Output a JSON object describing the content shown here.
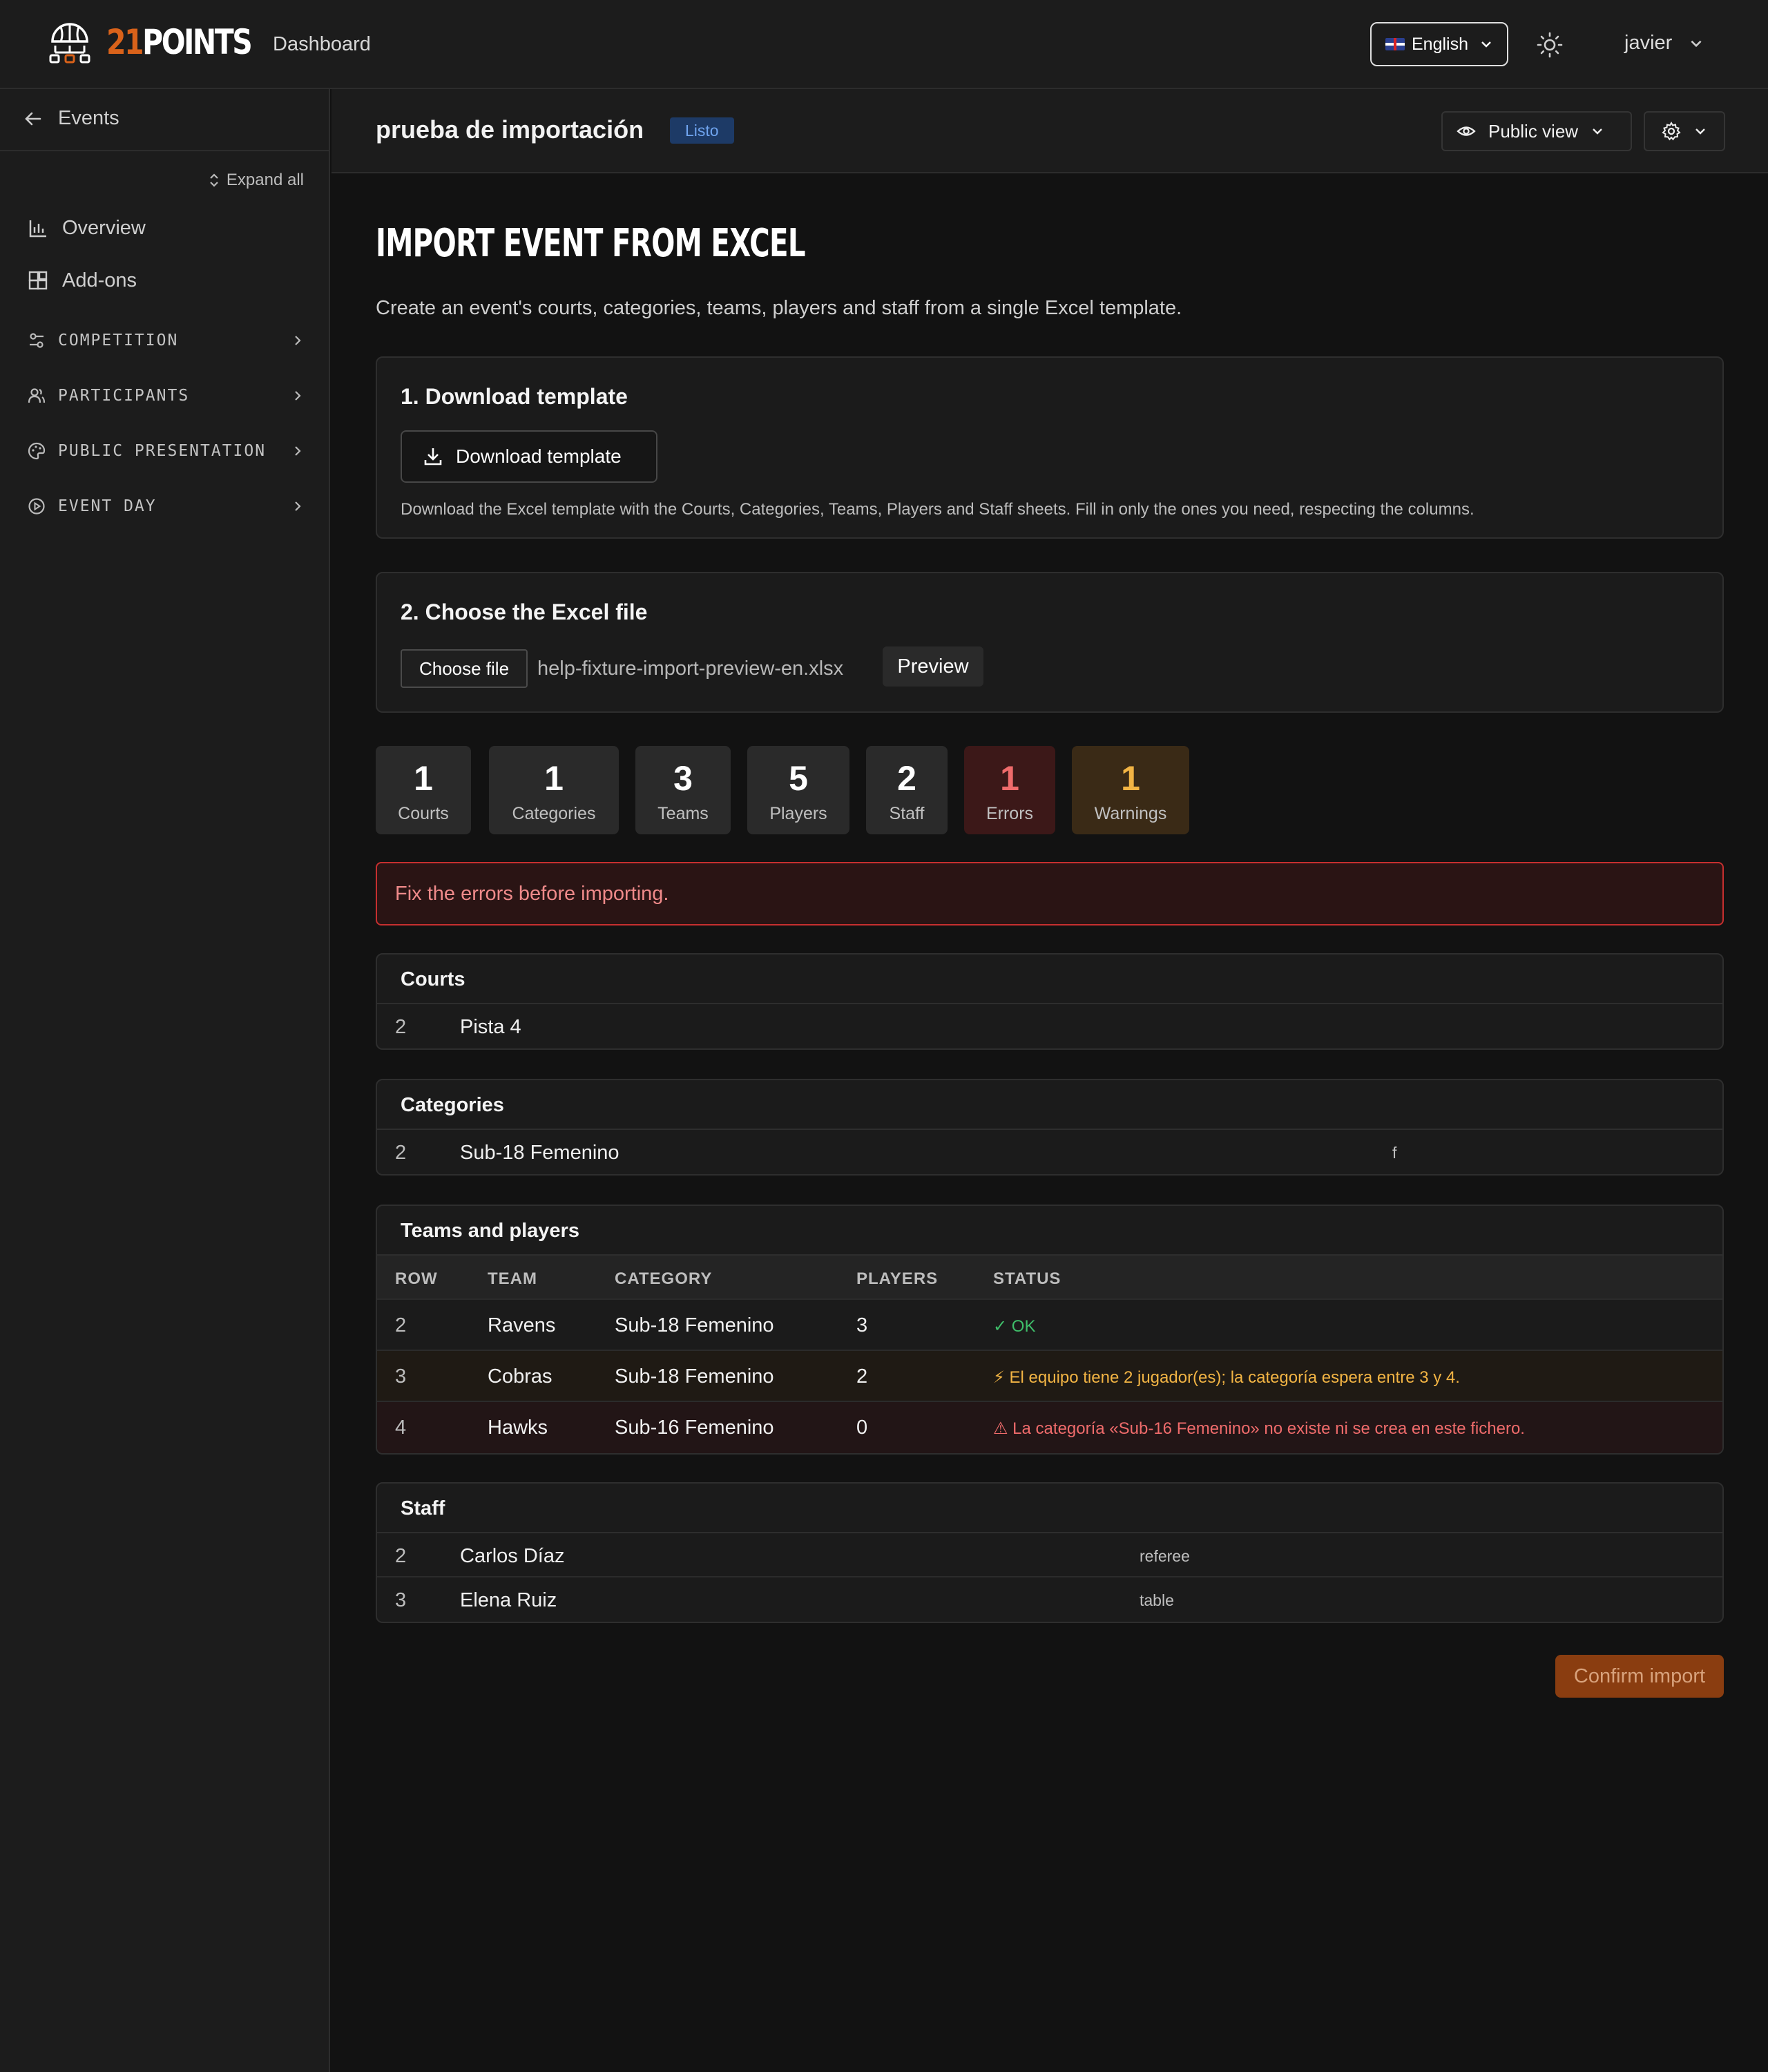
{
  "topbar": {
    "logo_num": "21",
    "logo_word": "POINTS",
    "nav_dashboard": "Dashboard",
    "language": "English",
    "user": "javier"
  },
  "sidebar": {
    "back": "Events",
    "expand_all": "Expand all",
    "links": [
      {
        "label": "Overview",
        "icon": "bar-chart-icon"
      },
      {
        "label": "Add-ons",
        "icon": "puzzle-icon"
      }
    ],
    "groups": [
      {
        "label": "COMPETITION",
        "icon": "sliders-icon"
      },
      {
        "label": "PARTICIPANTS",
        "icon": "users-icon"
      },
      {
        "label": "PUBLIC PRESENTATION",
        "icon": "palette-icon"
      },
      {
        "label": "EVENT DAY",
        "icon": "play-circle-icon"
      }
    ]
  },
  "header": {
    "title": "prueba de importación",
    "status": "Listo",
    "public_view": "Public view"
  },
  "main": {
    "heading": "IMPORT EVENT FROM EXCEL",
    "intro": "Create an event's courts, categories, teams, players and staff from a single Excel template.",
    "step1": {
      "title": "1. Download template",
      "button": "Download template",
      "help": "Download the Excel template with the Courts, Categories, Teams, Players and Staff sheets. Fill in only the ones you need, respecting the columns."
    },
    "step2": {
      "title": "2. Choose the Excel file",
      "choose": "Choose file",
      "file_name": "help-fixture-import-preview-en.xlsx",
      "preview": "Preview"
    },
    "stats": [
      {
        "value": "1",
        "label": "Courts"
      },
      {
        "value": "1",
        "label": "Categories"
      },
      {
        "value": "3",
        "label": "Teams"
      },
      {
        "value": "5",
        "label": "Players"
      },
      {
        "value": "2",
        "label": "Staff"
      },
      {
        "value": "1",
        "label": "Errors"
      },
      {
        "value": "1",
        "label": "Warnings"
      }
    ],
    "alert": "Fix the errors before importing.",
    "courts": {
      "title": "Courts",
      "rows": [
        {
          "row": "2",
          "name": "Pista 4"
        }
      ]
    },
    "categories": {
      "title": "Categories",
      "rows": [
        {
          "row": "2",
          "name": "Sub-18 Femenino",
          "gender": "f"
        }
      ]
    },
    "teams": {
      "title": "Teams and players",
      "columns": [
        "ROW",
        "TEAM",
        "CATEGORY",
        "PLAYERS",
        "STATUS"
      ],
      "rows": [
        {
          "row": "2",
          "team": "Ravens",
          "category": "Sub-18 Femenino",
          "players": "3",
          "status": "✓ OK"
        },
        {
          "row": "3",
          "team": "Cobras",
          "category": "Sub-18 Femenino",
          "players": "2",
          "status": "⚡ El equipo tiene 2 jugador(es); la categoría espera entre 3 y 4."
        },
        {
          "row": "4",
          "team": "Hawks",
          "category": "Sub-16 Femenino",
          "players": "0",
          "status": "⚠ La categoría «Sub-16 Femenino» no existe ni se crea en este fichero."
        }
      ]
    },
    "staff": {
      "title": "Staff",
      "rows": [
        {
          "row": "2",
          "name": "Carlos Díaz",
          "role": "referee"
        },
        {
          "row": "3",
          "name": "Elena Ruiz",
          "role": "table"
        }
      ]
    },
    "confirm": "Confirm import"
  },
  "colors": {
    "accent": "#d9621a",
    "error": "#ef6b6b",
    "warning": "#f2b444",
    "ok": "#3fbf6a"
  }
}
